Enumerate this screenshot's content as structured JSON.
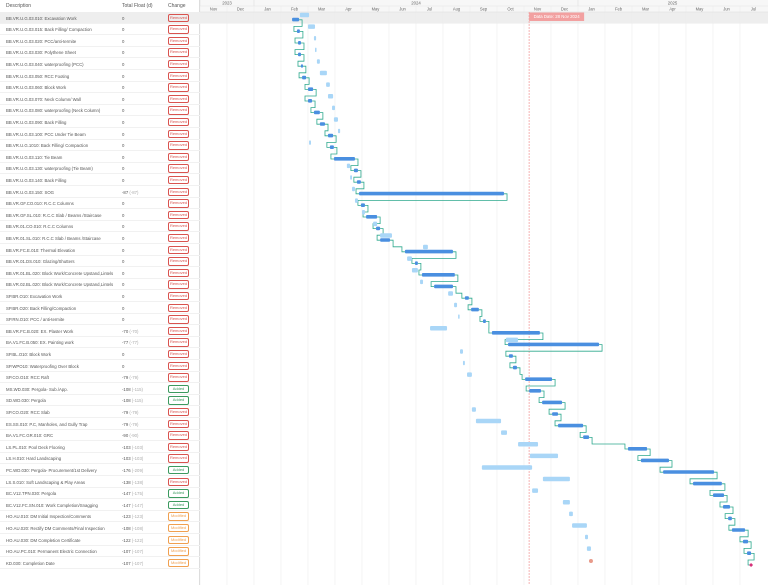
{
  "table": {
    "headers": {
      "description": "Description",
      "float": "Total Float (d)",
      "change": "Change"
    }
  },
  "timeline": {
    "years": [
      {
        "label": "2023",
        "from": 0,
        "to": 2
      },
      {
        "label": "2024",
        "from": 2,
        "to": 14
      },
      {
        "label": "2025",
        "from": 14,
        "to": 21
      }
    ],
    "months": [
      "Nov",
      "Dec",
      "Jan",
      "Feb",
      "Mar",
      "Apr",
      "May",
      "Jun",
      "Jul",
      "Aug",
      "Sep",
      "Oct",
      "Nov",
      "Dec",
      "Jan",
      "Feb",
      "Mar",
      "Apr",
      "May",
      "Jun",
      "Jul"
    ],
    "origin": "2023-11-01",
    "unit": "months since origin",
    "data_date": {
      "label": "Data Date: 28 Nov 2024",
      "value": 12.19
    }
  },
  "colors": {
    "bar": "#4a8fe0",
    "baseline": "#a9d6f7",
    "link": "#2ea98e",
    "removed": "#d9534f",
    "added": "#3c9a5f",
    "modified": "#f0a050",
    "datedate": "#f2a0a0"
  },
  "chart_data": {
    "type": "gantt",
    "selected_row": 0,
    "rows": [
      {
        "d": "BB.VR.U.G.03.010: Excavation Work",
        "f": "0",
        "fb": "",
        "c": "Removed",
        "bar": [
          3.41,
          3.67
        ],
        "bl": [
          3.7,
          4.04
        ]
      },
      {
        "d": "BB.VR.U.G.03.015: Back Filling/ Compaction",
        "f": "0",
        "fb": "",
        "c": "Removed",
        "bar": [
          3.59,
          3.7
        ],
        "bl": [
          4.0,
          4.26
        ]
      },
      {
        "d": "BB.VR.U.G.03.020: PCC/anti-termite",
        "f": "0",
        "fb": "",
        "c": "Removed",
        "bar": [
          3.63,
          3.74
        ],
        "bl": [
          4.22,
          4.3
        ]
      },
      {
        "d": "BB.VR.U.G.03.030: Polythene Sheet",
        "f": "0",
        "fb": "",
        "c": "Removed",
        "bar": [
          3.63,
          3.74
        ],
        "bl": [
          4.26,
          4.3
        ]
      },
      {
        "d": "BB.VR.U.G.03.040: waterproofing (PCC)",
        "f": "0",
        "fb": "",
        "c": "Removed",
        "bar": [
          3.74,
          3.81
        ],
        "bl": [
          4.33,
          4.44
        ]
      },
      {
        "d": "BB.VR.U.G.03.050: RCC Footing",
        "f": "0",
        "fb": "",
        "c": "Removed",
        "bar": [
          3.78,
          3.93
        ],
        "bl": [
          4.44,
          4.7
        ]
      },
      {
        "d": "BB.VR.U.G.03.060: Block Work",
        "f": "0",
        "fb": "",
        "c": "Removed",
        "bar": [
          4.0,
          4.19
        ],
        "bl": [
          4.67,
          4.81
        ]
      },
      {
        "d": "BB.VR.U.G.03.070: Neck Column/ Wall",
        "f": "0",
        "fb": "",
        "c": "Removed",
        "bar": [
          4.0,
          4.15
        ],
        "bl": [
          4.74,
          4.93
        ]
      },
      {
        "d": "BB.VR.U.G.03.080: waterproofing (Neck Column)",
        "f": "0",
        "fb": "",
        "c": "Removed",
        "bar": [
          4.22,
          4.44
        ],
        "bl": [
          4.89,
          5.0
        ]
      },
      {
        "d": "BB.VR.U.G.03.090: Back Filling",
        "f": "0",
        "fb": "",
        "c": "Removed",
        "bar": [
          4.44,
          4.63
        ],
        "bl": [
          4.96,
          5.11
        ]
      },
      {
        "d": "BB.VR.U.G.03.100: PCC Under Tie Beam",
        "f": "0",
        "fb": "",
        "c": "Removed",
        "bar": [
          4.74,
          4.93
        ],
        "bl": [
          5.11,
          5.19
        ]
      },
      {
        "d": "BB.VR.U.G.1010: Back Filling/ Compaction",
        "f": "0",
        "fb": "",
        "c": "Removed",
        "bar": [
          4.81,
          4.96
        ],
        "bl": [
          4.04,
          4.11
        ]
      },
      {
        "d": "BB.VR.U.G.03.110: Tie Beam",
        "f": "0",
        "fb": "",
        "c": "Removed",
        "bar": [
          4.96,
          5.74
        ],
        "bl": null
      },
      {
        "d": "BB.VR.U.G.03.130: waterproofing (Tie Beam)",
        "f": "0",
        "fb": "",
        "c": "Removed",
        "bar": [
          5.7,
          5.85
        ],
        "bl": [
          5.44,
          5.56
        ]
      },
      {
        "d": "BB.VR.U.G.03.140: Back Filling",
        "f": "0",
        "fb": "",
        "c": "Removed",
        "bar": [
          5.81,
          5.96
        ],
        "bl": [
          5.56,
          5.63
        ]
      },
      {
        "d": "BB.VR.U.G.03.150: SOG",
        "f": "-87",
        "fb": "(-87)",
        "c": "Removed",
        "bar": [
          5.89,
          11.26
        ],
        "bl": [
          5.63,
          5.74
        ]
      },
      {
        "d": "BB.VR.GF.CO.010: R.C.C Columns",
        "f": "0",
        "fb": "",
        "c": "Removed",
        "bar": [
          5.96,
          6.11
        ],
        "bl": [
          5.74,
          5.85
        ]
      },
      {
        "d": "BB.VR.GF.SL.010: R.C.C Slab / Beams /Staircase",
        "f": "0",
        "fb": "",
        "c": "Removed",
        "bar": [
          6.15,
          6.56
        ],
        "bl": [
          6.0,
          6.11
        ]
      },
      {
        "d": "BB.VR.01.CO.010: R.C.C Columns",
        "f": "0",
        "fb": "",
        "c": "Removed",
        "bar": [
          6.52,
          6.67
        ],
        "bl": [
          6.41,
          6.56
        ]
      },
      {
        "d": "BB.VR.01.SL.010: R.C.C Slab / Beams /Staircase",
        "f": "0",
        "fb": "",
        "c": "Removed",
        "bar": [
          6.67,
          7.04
        ],
        "bl": [
          6.67,
          7.11
        ]
      },
      {
        "d": "BB.VR.FC.E.010: Thermal Elevation",
        "f": "0",
        "fb": "",
        "c": "Removed",
        "bar": [
          7.59,
          9.37
        ],
        "bl": [
          8.26,
          8.44
        ]
      },
      {
        "d": "BB.VR.01.DS.010: Glazing/Shutters",
        "f": "0",
        "fb": "",
        "c": "Removed",
        "bar": [
          7.96,
          8.07
        ],
        "bl": [
          7.67,
          7.85
        ]
      },
      {
        "d": "BB.VR.01.BL.020: Block Work/Concrete Upstand,Lintels",
        "f": "0",
        "fb": "",
        "c": "Removed",
        "bar": [
          8.22,
          9.44
        ],
        "bl": [
          7.85,
          8.07
        ]
      },
      {
        "d": "BB.VR.02.BL.020: Block Work/Concrete Upstand,Lintels",
        "f": "0",
        "fb": "",
        "c": "Removed",
        "bar": [
          8.67,
          9.37
        ],
        "bl": [
          8.15,
          8.26
        ]
      },
      {
        "d": "SP.BR.O10: Excavation Work",
        "f": "0",
        "fb": "",
        "c": "Removed",
        "bar": [
          9.81,
          9.96
        ],
        "bl": [
          9.19,
          9.37
        ]
      },
      {
        "d": "SP.BR.O20: Back Filling/Compaction",
        "f": "0",
        "fb": "",
        "c": "Removed",
        "bar": [
          10.04,
          10.33
        ],
        "bl": [
          9.41,
          9.52
        ]
      },
      {
        "d": "SP.RN.O10: PCC / anti-termite",
        "f": "0",
        "fb": "",
        "c": "Removed",
        "bar": [
          10.48,
          10.59
        ],
        "bl": [
          9.56,
          9.59
        ]
      },
      {
        "d": "BB.VR.FC.B.020: EX. Plaster Work",
        "f": "-70",
        "fb": "(-70)",
        "c": "Removed",
        "bar": [
          10.81,
          12.59
        ],
        "bl": [
          8.52,
          9.15
        ]
      },
      {
        "d": "BA.V1.FC.B.050: EX. Painting work",
        "f": "-77",
        "fb": "(-77)",
        "c": "Removed",
        "bar": [
          11.41,
          14.78
        ],
        "bl": [
          11.33,
          11.78
        ]
      },
      {
        "d": "SP.BL.O10: Block Work",
        "f": "0",
        "fb": "",
        "c": "Removed",
        "bar": [
          11.44,
          11.59
        ],
        "bl": [
          9.63,
          9.74
        ]
      },
      {
        "d": "SP.WPO10: Waterproofing Over Block",
        "f": "0",
        "fb": "",
        "c": "Removed",
        "bar": [
          11.59,
          11.74
        ],
        "bl": [
          9.74,
          9.81
        ]
      },
      {
        "d": "SP.CO.O10: RCC Raft",
        "f": "-79",
        "fb": "(-79)",
        "c": "Removed",
        "bar": [
          12.04,
          13.04
        ],
        "bl": [
          9.89,
          10.07
        ]
      },
      {
        "d": "MS.WD.030: Pergola- Sub./App.",
        "f": "-108",
        "fb": "(-115)",
        "c": "Added",
        "bar": [
          12.19,
          12.63
        ],
        "bl": null
      },
      {
        "d": "SD.WD.030: Pergola",
        "f": "-108",
        "fb": "(-115)",
        "c": "Added",
        "bar": [
          12.67,
          13.41
        ],
        "bl": null
      },
      {
        "d": "SP.CO.O20: RCC Slab",
        "f": "-79",
        "fb": "(-79)",
        "c": "Removed",
        "bar": [
          13.04,
          13.26
        ],
        "bl": [
          10.07,
          10.22
        ]
      },
      {
        "d": "ES.SS.010: P.C, Manholes, and Gully Trap",
        "f": "-79",
        "fb": "(-79)",
        "c": "Removed",
        "bar": [
          13.26,
          14.19
        ],
        "bl": [
          10.22,
          11.15
        ]
      },
      {
        "d": "BA.V1.FC.GR.010: GRC",
        "f": "-90",
        "fb": "(-90)",
        "c": "Removed",
        "bar": [
          14.19,
          14.41
        ],
        "bl": [
          11.15,
          11.37
        ]
      },
      {
        "d": "LS.PL.010: Pool Deck Flooring",
        "f": "-103",
        "fb": "(-103)",
        "c": "Removed",
        "bar": [
          15.85,
          16.56
        ],
        "bl": [
          11.78,
          12.52
        ]
      },
      {
        "d": "LS.H.010: Hard Landscaping",
        "f": "-103",
        "fb": "(-103)",
        "c": "Removed",
        "bar": [
          16.33,
          17.37
        ],
        "bl": [
          12.22,
          13.26
        ]
      },
      {
        "d": "PC.WD.030: Pergola- Procurement/1st Delivery",
        "f": "-176",
        "fb": "(-209)",
        "c": "Added",
        "bar": [
          17.15,
          19.04
        ],
        "bl": [
          10.44,
          12.3
        ]
      },
      {
        "d": "LS.S.010: Soft Landscaping & Play Areas",
        "f": "-138",
        "fb": "(-138)",
        "c": "Removed",
        "bar": [
          18.26,
          19.33
        ],
        "bl": [
          12.7,
          13.7
        ]
      },
      {
        "d": "BC.V12.TPN.030: Pergola",
        "f": "-147",
        "fb": "(-175)",
        "c": "Added",
        "bar": [
          19.0,
          19.41
        ],
        "bl": [
          12.3,
          12.52
        ]
      },
      {
        "d": "BC.V12.FC.SN.010: Work Completion/Snagging",
        "f": "-147",
        "fb": "(-147)",
        "c": "Added",
        "bar": [
          19.37,
          19.63
        ],
        "bl": [
          13.44,
          13.7
        ]
      },
      {
        "d": "HO.AU.010: DM Initial Inspection/Comments",
        "f": "-123",
        "fb": "(-123)",
        "c": "Modified",
        "bar": [
          19.56,
          19.7
        ],
        "bl": [
          13.67,
          13.81
        ]
      },
      {
        "d": "HO.AU.020: Rectify DM Comments/Final Inspection",
        "f": "-108",
        "fb": "(-108)",
        "c": "Modified",
        "bar": [
          19.7,
          20.19
        ],
        "bl": [
          13.78,
          14.33
        ]
      },
      {
        "d": "HO.AU.030: DM Completion Certificate",
        "f": "-122",
        "fb": "(-122)",
        "c": "Modified",
        "bar": [
          20.11,
          20.3
        ],
        "bl": [
          14.26,
          14.37
        ]
      },
      {
        "d": "HO.AU.PC.010: Permanent Electric Connection",
        "f": "-107",
        "fb": "(-107)",
        "c": "Modified",
        "bar": [
          20.26,
          20.41
        ],
        "bl": [
          14.33,
          14.48
        ]
      },
      {
        "d": "KD.030: Completion Date",
        "f": "-107",
        "fb": "(-107)",
        "c": "Modified",
        "bar": [
          20.41,
          20.41
        ],
        "bl": [
          14.48,
          14.48
        ],
        "milestone": true
      }
    ]
  }
}
